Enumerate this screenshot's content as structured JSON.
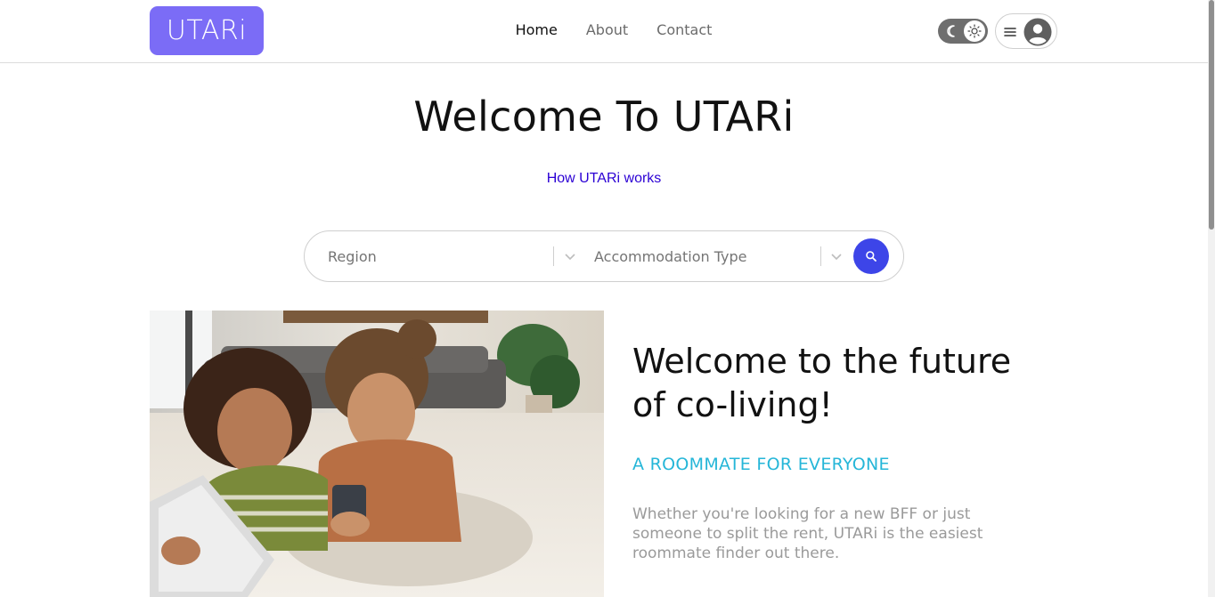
{
  "header": {
    "logo_text": "UTARi",
    "nav": [
      {
        "label": "Home",
        "active": true
      },
      {
        "label": "About",
        "active": false
      },
      {
        "label": "Contact",
        "active": false
      }
    ],
    "theme_toggle": {
      "mode": "light",
      "icons": [
        "moon-icon",
        "sun-icon"
      ]
    },
    "user_menu": {
      "icons": [
        "menu-icon",
        "user-avatar-icon"
      ]
    }
  },
  "hero": {
    "title": "Welcome To UTARi",
    "link": "How UTARi works"
  },
  "search": {
    "region_placeholder": "Region",
    "accommodation_placeholder": "Accommodation Type",
    "button_icon": "search-icon"
  },
  "feature": {
    "title": "Welcome to the future of co-living!",
    "subtitle": "A ROOMMATE FOR EVERYONE",
    "body": "Whether you're looking for a new BFF or just someone to split the rent, UTARi is the easiest roommate finder out there."
  },
  "colors": {
    "brand": "#7b6cf6",
    "accent": "#3d45e8",
    "link": "#2b00d4",
    "subtitle": "#25b6d8"
  }
}
